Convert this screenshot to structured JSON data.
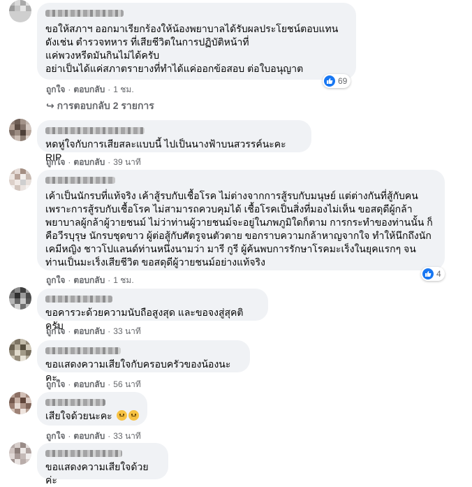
{
  "comments": [
    {
      "text": "ขอให้สภาฯ ออกมาเรียกร้องให้น้องพยาบาลได้รับผลประโยชน์ตอบแทน\nดังเช่น ตำรวจทหาร ที่เสียชีวิตในการปฏิบัติหน้าที่\nแค่พวงหรีดมันกินไม่ได้ครับ\nอย่าเป็นได้แค่สภาตรายางที่ทำได้แค่ออกข้อสอบ ต่อใบอนุญาต",
      "like": "ถูกใจ",
      "reply": "ตอบกลับ",
      "time": "1 ชม.",
      "reaction_count": "69",
      "replies": "↪ การตอบกลับ 2 รายการ"
    },
    {
      "text": "หดหู่ใจกับการเสียสละแบบนี้ ไปเป็นนางฟ้าบนสวรรค์นะคะ RIP",
      "like": "ถูกใจ",
      "reply": "ตอบกลับ",
      "time": "39 นาที"
    },
    {
      "text": "เค้าเป็นนักรบที่แท้จริง เค้าสู้รบกับเชื้อโรค ไม่ต่างจากการสู้รบกับมนุษย์ แต่ต่างกันที่สู้กับคน\nเพราะการสู้รบกับเชื้อโรค ไม่สามารถควบคุมได้ เชื้อโรคเป็นสิ่งที่มองไม่เห็น ขอสดุดีผู้กล้า\nพยาบาลผู้กล้าผู้วายชนม์ ไม่ว่าท่านผู้วายชนม์จะอยู่ในภพภูมิใดก็ตาม การกระทำของท่านนั้น ก็\nคือวีรบุรุษ นักรบชุดขาว ผู้ต่อสู้กับศัตรูจนตัวตาย ขอกราบความกล้าหาญจากใจ ทำให้นึกถึงนัก\nเคมีหญิง ชาวโปแลนด์ท่านหนึ่งนามว่า มารี กูรี ผู้ค้นพบการรักษาโรคมะเร็งในยุคแรกๆ จน\nท่านเป็นมะเร็งเสียชีวิต ขอสดุดีผู้วายชนม์อย่างแท้จริง",
      "like": "ถูกใจ",
      "reply": "ตอบกลับ",
      "time": "1 ชม.",
      "reaction_count": "4"
    },
    {
      "text": "ขอคารวะด้วยความนับถือสูงสุด และขอจงสู่สุคติครับ",
      "like": "ถูกใจ",
      "reply": "ตอบกลับ",
      "time": "33 นาที"
    },
    {
      "text": "ขอแสดงความเสียใจกับครอบครัวของน้องนะคะ",
      "like": "ถูกใจ",
      "reply": "ตอบกลับ",
      "time": "56 นาที"
    },
    {
      "text": "เสียใจด้วยนะคะ",
      "like": "ถูกใจ",
      "reply": "ตอบกลับ",
      "time": "33 นาที",
      "emojis": [
        "sad-face-icon",
        "sad-face-icon"
      ]
    },
    {
      "text": "ขอแสดงความเสียใจด้วยค่ะ"
    }
  ],
  "colors": {
    "bubble": "#f0f2f5",
    "meta_text": "#65676b",
    "like_blue": "#1877f2"
  }
}
